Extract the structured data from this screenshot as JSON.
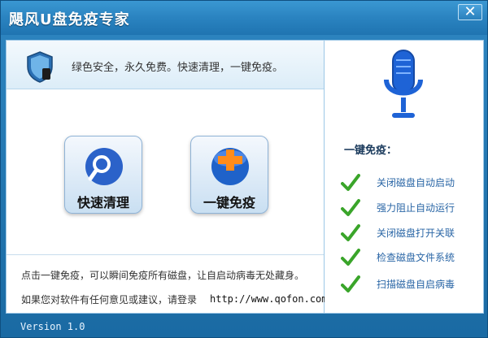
{
  "window": {
    "title": "飓风U盘免疫专家",
    "close_label": "✕"
  },
  "left": {
    "slogan": "绿色安全，永久免费。快速清理，一键免疫。",
    "buttons": {
      "quick_clean": "快速清理",
      "one_click": "一键免疫"
    },
    "description": "点击一键免疫，可以瞬间免疫所有磁盘，让自启动病毒无处藏身。",
    "feedback": "如果您对软件有任何意见或建议，请登录",
    "url": "http://www.qofon.com"
  },
  "right": {
    "title": "一键免疫：",
    "features": [
      "关闭磁盘自动启动",
      "强力阻止自动运行",
      "关闭磁盘打开关联",
      "检查磁盘文件系统",
      "扫描磁盘自启病毒"
    ]
  },
  "status": {
    "version": "Version 1.0"
  },
  "icons": {
    "shield": "shield-icon",
    "search": "magnifier-icon",
    "plus": "plus-icon",
    "mic": "microphone-icon",
    "check": "check-icon"
  },
  "colors": {
    "accent": "#1f74b1",
    "check": "#3aa52a",
    "mic_blue": "#1e63d6"
  }
}
